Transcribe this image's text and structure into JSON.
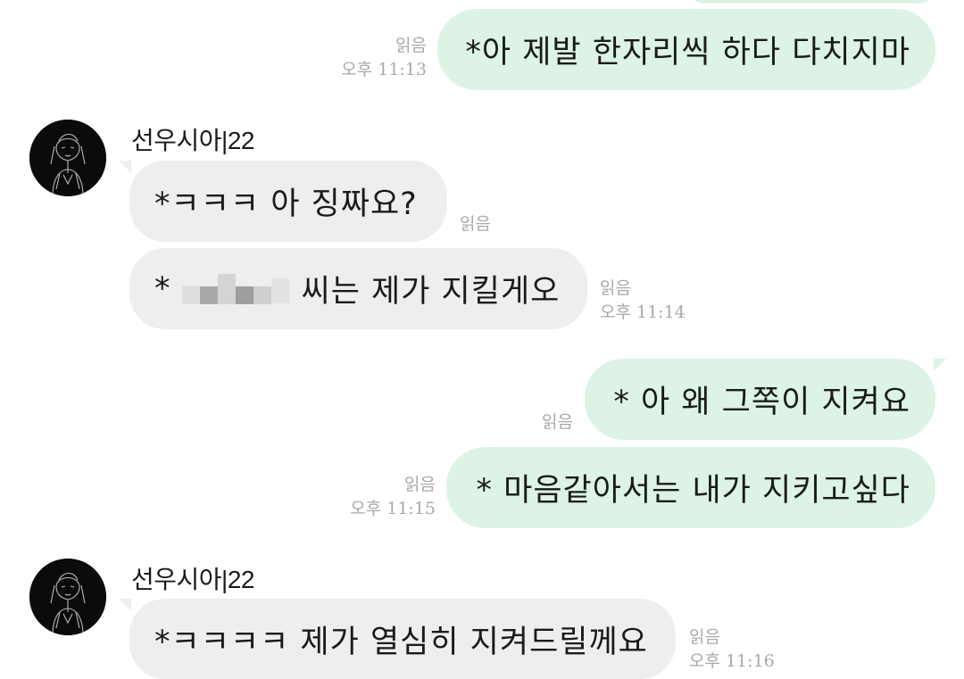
{
  "messages": [
    {
      "id": "m1",
      "direction": "out",
      "text": "*아 제발 한자리씩 하다 다치지마",
      "read": "읽음",
      "time": "오후 11:13"
    },
    {
      "id": "m2",
      "direction": "in",
      "sender": "선우시아|22",
      "text": "*ㅋㅋㅋ 아 징짜요?",
      "read": "읽음",
      "time": ""
    },
    {
      "id": "m3",
      "direction": "in",
      "text_prefix": "*",
      "text_suffix": "씨는 제가 지킬게오",
      "redacted": true,
      "read": "읽음",
      "time": "오후 11:14"
    },
    {
      "id": "m4",
      "direction": "out",
      "text": "* 아 왜 그쪽이 지켜요",
      "read": "읽음",
      "time": ""
    },
    {
      "id": "m5",
      "direction": "out",
      "text": "* 마음같아서는 내가 지키고싶다",
      "read": "읽음",
      "time": "오후 11:15"
    },
    {
      "id": "m6",
      "direction": "in",
      "sender": "선우시아|22",
      "text": "*ㅋㅋㅋㅋ 제가 열심히 지켜드릴께요",
      "read": "읽음",
      "time": "오후 11:16"
    }
  ],
  "colors": {
    "outgoing_bubble": "#dcf3e6",
    "incoming_bubble": "#eeeeef",
    "meta_text": "#a8a8a8",
    "avatar_bg": "#0b0b0b"
  },
  "icons": {
    "avatar": "avatar-sketch-figure-icon"
  }
}
